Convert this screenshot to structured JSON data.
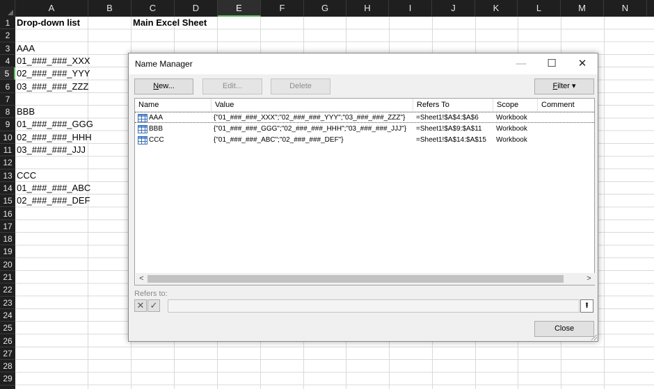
{
  "sheet": {
    "columns": [
      "A",
      "B",
      "C",
      "D",
      "E",
      "F",
      "G",
      "H",
      "I",
      "J",
      "K",
      "L",
      "M",
      "N"
    ],
    "active_column": "E",
    "rows": [
      "1",
      "2",
      "3",
      "4",
      "5",
      "6",
      "7",
      "8",
      "9",
      "10",
      "11",
      "12",
      "13",
      "14",
      "15",
      "16",
      "17",
      "18",
      "19",
      "20",
      "21",
      "22",
      "23",
      "24",
      "25",
      "26",
      "27",
      "28",
      "29"
    ],
    "active_row": "5",
    "cells": {
      "a1": "Drop-down list",
      "c1": "Main Excel Sheet",
      "a3": "AAA",
      "a4": "01_###_###_XXX",
      "a5": "02_###_###_YYY",
      "a6": "03_###_###_ZZZ",
      "a8": "BBB",
      "a9": "01_###_###_GGG",
      "a10": "02_###_###_HHH",
      "a11": "03_###_###_JJJ",
      "a13": "CCC",
      "a14": "01_###_###_ABC",
      "a15": "02_###_###_DEF"
    }
  },
  "dialog": {
    "title": "Name Manager",
    "minimize_glyph": "—",
    "maximize_glyph": "☐",
    "close_glyph": "✕",
    "buttons": {
      "new_ul": "N",
      "new_rest": "ew...",
      "edit": "Edit...",
      "delete": "Delete",
      "filter_ul": "F",
      "filter_rest": "ilter",
      "filter_arrow": "▾",
      "close": "Close"
    },
    "columns": {
      "name": "Name",
      "value": "Value",
      "refers_to": "Refers To",
      "scope": "Scope",
      "comment": "Comment"
    },
    "rows": [
      {
        "name": "AAA",
        "value": "{\"01_###_###_XXX\";\"02_###_###_YYY\";\"03_###_###_ZZZ\"}",
        "refers_to": "=Sheet1!$A$4:$A$6",
        "scope": "Workbook",
        "comment": ""
      },
      {
        "name": "BBB",
        "value": "{\"01_###_###_GGG\";\"02_###_###_HHH\";\"03_###_###_JJJ\"}",
        "refers_to": "=Sheet1!$A$9:$A$11",
        "scope": "Workbook",
        "comment": ""
      },
      {
        "name": "CCC",
        "value": "{\"01_###_###_ABC\";\"02_###_###_DEF\"}",
        "refers_to": "=Sheet1!$A$14:$A$15",
        "scope": "Workbook",
        "comment": ""
      }
    ],
    "refers_to_label": "Refers to:",
    "refers_to_value": "",
    "cancel_glyph": "✕",
    "confirm_glyph": "✓",
    "collapse_glyph": "⭱",
    "scroll_left_glyph": "<",
    "scroll_right_glyph": ">"
  },
  "colors": {
    "header_bg": "#1f1f1f",
    "active_accent": "#5cb85c",
    "name_icon": "#3a6fb5"
  }
}
